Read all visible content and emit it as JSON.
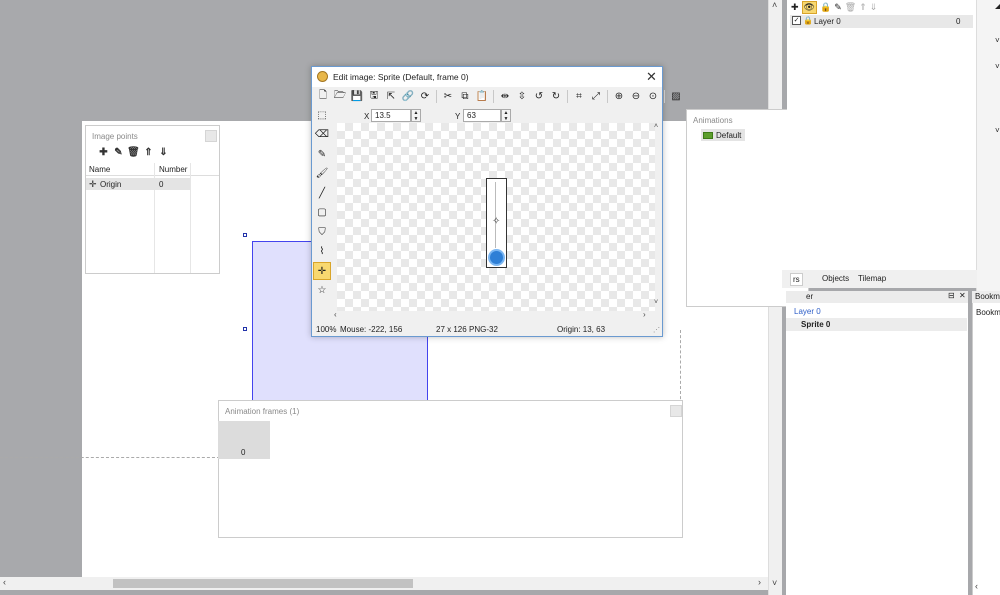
{
  "image_points": {
    "title": "Image points",
    "col_name": "Name",
    "col_number": "Number",
    "rows": [
      {
        "name": "Origin",
        "number": "0"
      }
    ]
  },
  "animations": {
    "title": "Animations",
    "items": [
      "Default"
    ]
  },
  "animation_frames": {
    "title": "Animation frames (1)",
    "frames": [
      "0"
    ]
  },
  "dialog": {
    "title": "Edit image: Sprite (Default, frame 0)",
    "x_label": "X",
    "x_value": "13.5",
    "y_label": "Y",
    "y_value": "63",
    "status": {
      "zoom": "100%",
      "mouse": "Mouse: -222, 156",
      "size": "27 x 126",
      "format": "PNG-32",
      "origin": "Origin: 13, 63"
    }
  },
  "layers": {
    "rows": [
      {
        "name": "Layer 0",
        "number": "0"
      }
    ]
  },
  "project_tabs": [
    "rs",
    "Objects",
    "Tilemap"
  ],
  "layer_panel": {
    "title": "er",
    "layer_link": "Layer 0",
    "item": "Sprite 0"
  },
  "bookmarks": {
    "title": "Bookm",
    "item": "Bookm"
  },
  "colors": {
    "accent": "#4444ee",
    "tool_active": "#f8d870",
    "sprite_blue": "#2e7fd6"
  }
}
